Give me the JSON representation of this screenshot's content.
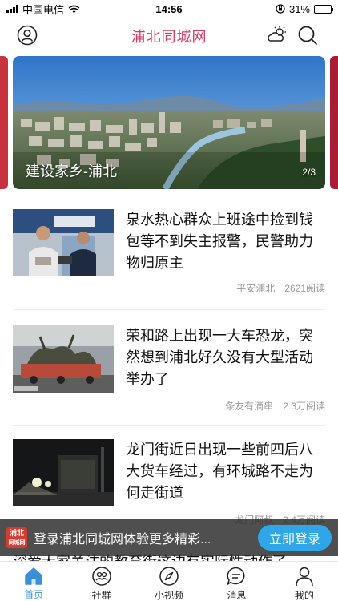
{
  "status_bar": {
    "carrier": "中国电信",
    "time": "14:56",
    "battery": "31%",
    "battery_level": 0.31
  },
  "header": {
    "title": "浦北同城网",
    "left_icon": "user-icon",
    "weather_icon": "weather-icon",
    "search_icon": "search-icon"
  },
  "banner": {
    "caption": "建设家乡-浦北",
    "page": "2/3"
  },
  "news": [
    {
      "title": "泉水热心群众上班途中捡到钱包等不到失主报警，民警助力物归原主",
      "source": "平安浦北",
      "reads": "2621阅读"
    },
    {
      "title": "荣和路上出现一大车恐龙，突然想到浦北好久没有大型活动举办了",
      "source": "条友有滴串",
      "reads": "2.3万阅读"
    },
    {
      "title": "龙门街近日出现一些前四后八大货车经过，有环城路不走为何走街道",
      "source": "龙门阿叔",
      "reads": "2.4万阅读"
    }
  ],
  "peek_text": "深爱大家关注的教育街这边有实际性动作了",
  "login_bar": {
    "logo_line1": "浦北",
    "logo_line2": "同城网",
    "text": "登录浦北同城网体验更多精彩...",
    "button": "立即登录"
  },
  "tabs": [
    {
      "label": "首页",
      "icon": "home-icon",
      "active": true
    },
    {
      "label": "社群",
      "icon": "community-icon",
      "active": false
    },
    {
      "label": "小视频",
      "icon": "compass-icon",
      "active": false
    },
    {
      "label": "消息",
      "icon": "message-icon",
      "active": false
    },
    {
      "label": "我的",
      "icon": "profile-icon",
      "active": false
    }
  ],
  "colors": {
    "title_pink": "#d63a62",
    "active_tab": "#3b8fd6",
    "login_button": "#2fa6e8"
  }
}
